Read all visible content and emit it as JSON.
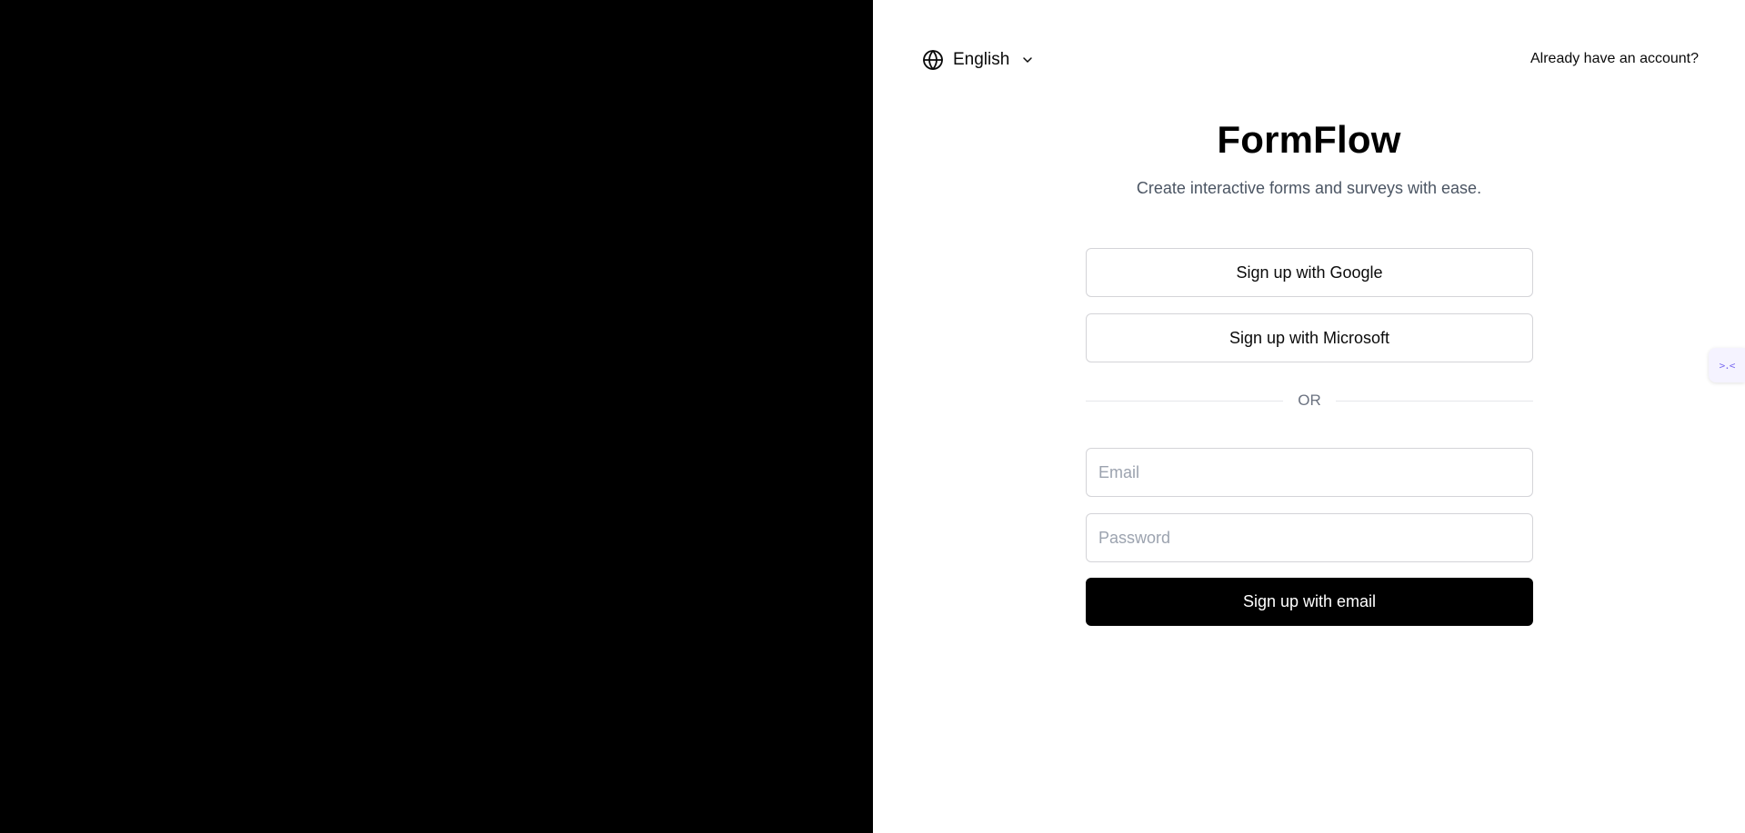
{
  "left_panel": {
    "background": "#000000"
  },
  "language": {
    "icon": "globe-icon",
    "selected": "English",
    "chevron": "chevron-down-icon"
  },
  "header": {
    "login_link": "Already have an account?"
  },
  "brand": {
    "title": "FormFlow",
    "subtitle": "Create interactive forms and surveys with ease."
  },
  "oauth": {
    "google_label": "Sign up with Google",
    "microsoft_label": "Sign up with Microsoft"
  },
  "divider": {
    "label": "OR"
  },
  "form": {
    "email_placeholder": "Email",
    "email_value": "",
    "password_placeholder": "Password",
    "password_value": "",
    "submit_label": "Sign up with email"
  },
  "side_widget": {
    "icon": "chatbot-icon",
    "glyph": ">.<"
  },
  "colors": {
    "primary": "#000000",
    "muted_text": "#4b5563",
    "border": "#d4d4d8",
    "placeholder": "#9ca3af"
  }
}
